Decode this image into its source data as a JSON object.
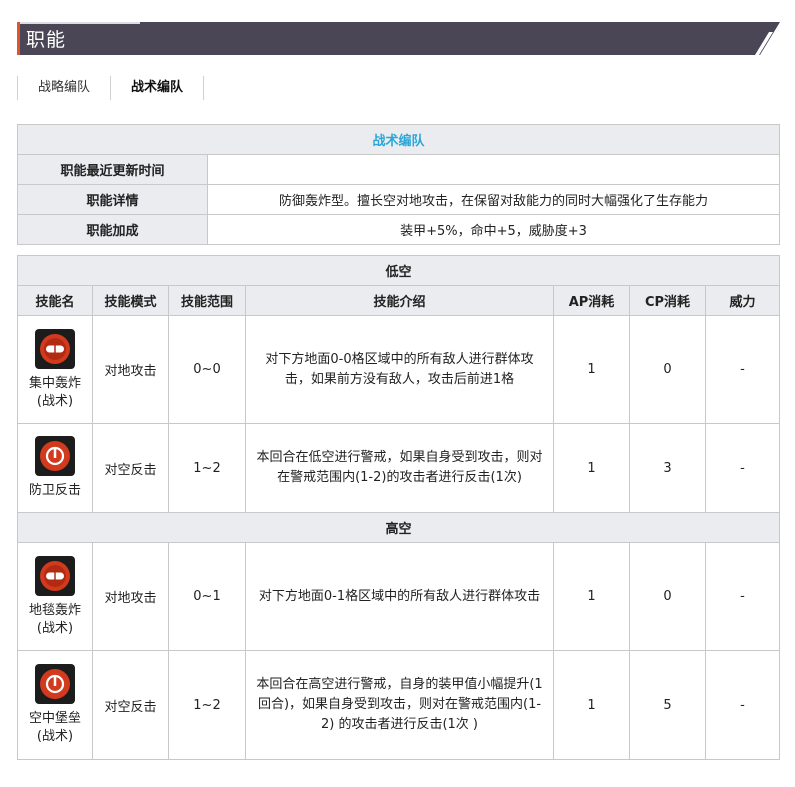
{
  "header": {
    "title": "职能"
  },
  "tabs": [
    {
      "label": "战略编队",
      "active": false
    },
    {
      "label": "战术编队",
      "active": true
    }
  ],
  "info_table": {
    "title": "战术编队",
    "rows": [
      {
        "label": "职能最近更新时间",
        "value": ""
      },
      {
        "label": "职能详情",
        "value": "防御轰炸型。擅长空对地攻击，在保留对敌能力的同时大幅强化了生存能力"
      },
      {
        "label": "职能加成",
        "value": "装甲+5%，命中+5，威胁度+3"
      }
    ]
  },
  "skills_table": {
    "headers": [
      "技能名",
      "技能模式",
      "技能范围",
      "技能介绍",
      "AP消耗",
      "CP消耗",
      "威力"
    ],
    "sections": [
      {
        "title": "低空",
        "skills": [
          {
            "name": "集中轰炸(战术)",
            "icon": "bomb-icon",
            "mode": "对地攻击",
            "range": "0~0",
            "desc": "对下方地面0-0格区域中的所有敌人进行群体攻击，如果前方没有敌人，攻击后前进1格",
            "ap": "1",
            "cp": "0",
            "power": "-"
          },
          {
            "name": "防卫反击",
            "icon": "counter-icon",
            "mode": "对空反击",
            "range": "1~2",
            "desc": "本回合在低空进行警戒，如果自身受到攻击，则对在警戒范围内(1-2)的攻击者进行反击(1次)",
            "ap": "1",
            "cp": "3",
            "power": "-"
          }
        ]
      },
      {
        "title": "高空",
        "skills": [
          {
            "name": "地毯轰炸(战术)",
            "icon": "bomb-icon",
            "mode": "对地攻击",
            "range": "0~1",
            "desc": "对下方地面0-1格区域中的所有敌人进行群体攻击",
            "ap": "1",
            "cp": "0",
            "power": "-"
          },
          {
            "name": "空中堡垒(战术)",
            "icon": "counter-icon",
            "mode": "对空反击",
            "range": "1~2",
            "desc": "本回合在高空进行警戒，自身的装甲值小幅提升(1回合)，如果自身受到攻击，则对在警戒范围内(1-2) 的攻击者进行反击(1次 )",
            "ap": "1",
            "cp": "5",
            "power": "-"
          }
        ]
      }
    ]
  },
  "colors": {
    "banner": "#4a4656",
    "accent": "#e0552d",
    "title_blue": "#2aa7d8",
    "header_grey": "#eaecf0"
  }
}
